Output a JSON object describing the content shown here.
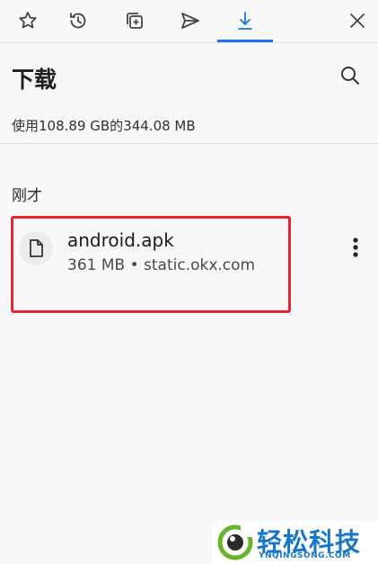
{
  "tabs": [
    {
      "icon": "star-icon"
    },
    {
      "icon": "history-icon"
    },
    {
      "icon": "add-tab-icon"
    },
    {
      "icon": "send-icon"
    },
    {
      "icon": "download-icon",
      "active": true
    },
    {
      "icon": "close-icon"
    }
  ],
  "header": {
    "title": "下载",
    "storage_text": "使用108.89 GB的344.08 MB"
  },
  "section": {
    "label": "刚才"
  },
  "downloads": [
    {
      "file_name": "android.apk",
      "meta": "361 MB • static.okx.com"
    }
  ],
  "watermark": {
    "text": "轻松科技",
    "sub": "YNQINGSONG.COM"
  },
  "colors": {
    "accent": "#1a73e8",
    "highlight_border": "#e8262b",
    "watermark_blue": "#1776c9",
    "watermark_green": "#6ab42d"
  }
}
